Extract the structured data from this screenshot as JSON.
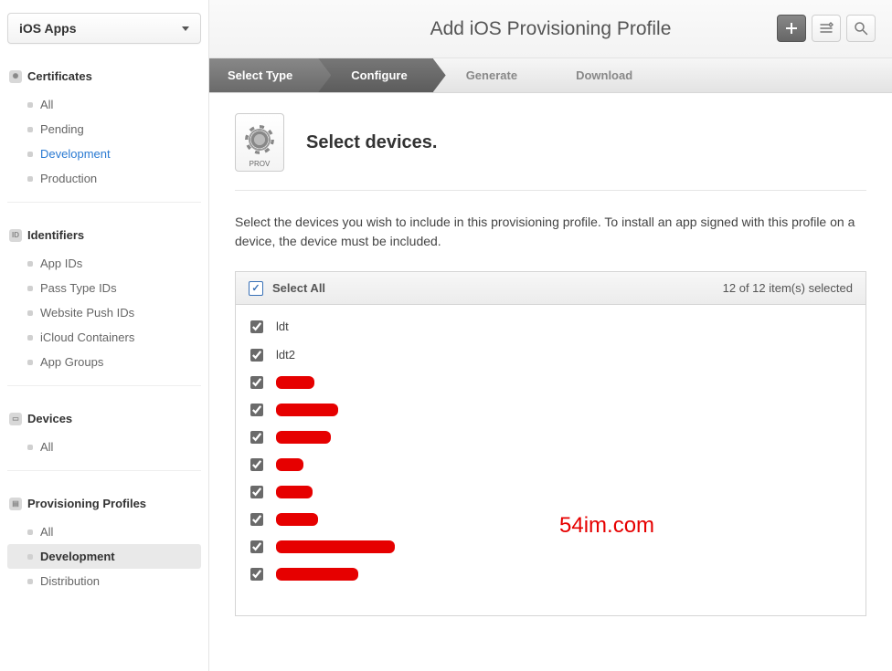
{
  "sidebar": {
    "dropdown_label": "iOS Apps",
    "groups": [
      {
        "icon": "✺",
        "title": "Certificates",
        "items": [
          {
            "label": "All",
            "state": ""
          },
          {
            "label": "Pending",
            "state": ""
          },
          {
            "label": "Development",
            "state": "link"
          },
          {
            "label": "Production",
            "state": ""
          }
        ]
      },
      {
        "icon": "ID",
        "title": "Identifiers",
        "items": [
          {
            "label": "App IDs",
            "state": ""
          },
          {
            "label": "Pass Type IDs",
            "state": ""
          },
          {
            "label": "Website Push IDs",
            "state": ""
          },
          {
            "label": "iCloud Containers",
            "state": ""
          },
          {
            "label": "App Groups",
            "state": ""
          }
        ]
      },
      {
        "icon": "▭",
        "title": "Devices",
        "items": [
          {
            "label": "All",
            "state": ""
          }
        ]
      },
      {
        "icon": "▤",
        "title": "Provisioning Profiles",
        "items": [
          {
            "label": "All",
            "state": ""
          },
          {
            "label": "Development",
            "state": "active"
          },
          {
            "label": "Distribution",
            "state": ""
          }
        ]
      }
    ]
  },
  "header": {
    "title": "Add iOS Provisioning Profile"
  },
  "stepper": [
    {
      "label": "Select Type",
      "state": "done"
    },
    {
      "label": "Configure",
      "state": "active"
    },
    {
      "label": "Generate",
      "state": ""
    },
    {
      "label": "Download",
      "state": ""
    }
  ],
  "content": {
    "file_badge": "PROV",
    "heading": "Select devices.",
    "description": "Select the devices you wish to include in this provisioning profile. To install an app signed with this profile on a device, the device must be included.",
    "select_all_label": "Select All",
    "count_text": "12 of 12 item(s) selected",
    "devices": [
      {
        "name": "ldt",
        "redacted": false,
        "redact_w": 0
      },
      {
        "name": "ldt2",
        "redacted": false,
        "redact_w": 0
      },
      {
        "name": "",
        "redacted": true,
        "redact_w": 42
      },
      {
        "name": "",
        "redacted": true,
        "redact_w": 68
      },
      {
        "name": "",
        "redacted": true,
        "redact_w": 60
      },
      {
        "name": "",
        "redacted": true,
        "redact_w": 30
      },
      {
        "name": "",
        "redacted": true,
        "redact_w": 40
      },
      {
        "name": "",
        "redacted": true,
        "redact_w": 46
      },
      {
        "name": "",
        "redacted": true,
        "redact_w": 130
      },
      {
        "name": "",
        "redacted": true,
        "redact_w": 90
      }
    ]
  },
  "watermark": "54im.com"
}
